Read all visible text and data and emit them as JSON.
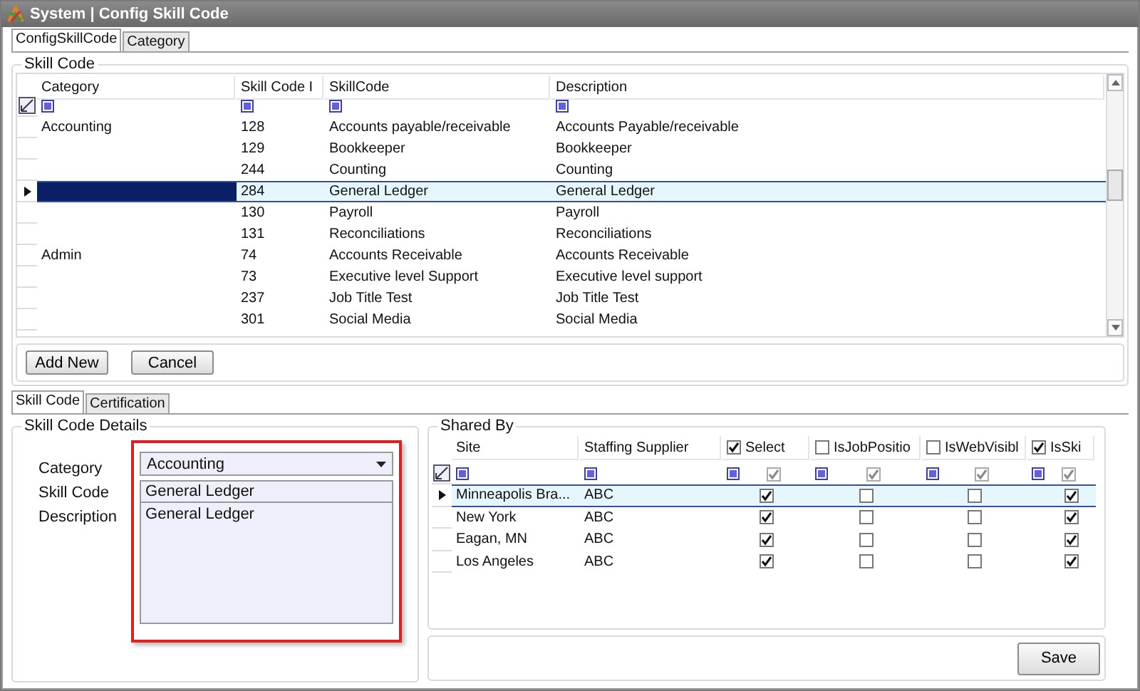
{
  "window": {
    "title": "System | Config Skill Code"
  },
  "top_tabs": [
    {
      "label": "ConfigSkillCode",
      "selected": true
    },
    {
      "label": "Category",
      "selected": false
    }
  ],
  "skill_code_group": {
    "title": "Skill Code",
    "columns": [
      "Category",
      "Skill Code I",
      "SkillCode",
      "Description"
    ],
    "rows": [
      {
        "category": "Accounting",
        "code": "128",
        "skill": "Accounts payable/receivable",
        "description": "Accounts Payable/receivable",
        "selected": false
      },
      {
        "code": "129",
        "skill": "Bookkeeper",
        "description": "Bookkeeper",
        "selected": false
      },
      {
        "code": "244",
        "skill": "Counting",
        "description": "Counting",
        "selected": false
      },
      {
        "code": "284",
        "skill": "General Ledger",
        "description": "General Ledger",
        "selected": true
      },
      {
        "code": "130",
        "skill": "Payroll",
        "description": "Payroll",
        "selected": false
      },
      {
        "code": "131",
        "skill": "Reconciliations",
        "description": "Reconciliations",
        "selected": false
      },
      {
        "category": "Admin",
        "code": "74",
        "skill": "Accounts Receivable",
        "description": "Accounts Receivable",
        "selected": false
      },
      {
        "code": "73",
        "skill": "Executive level Support",
        "description": "Executive level support",
        "selected": false
      },
      {
        "code": "237",
        "skill": "Job Title Test",
        "description": "Job Title Test",
        "selected": false
      },
      {
        "code": "301",
        "skill": "Social Media",
        "description": "Social Media",
        "selected": false
      }
    ]
  },
  "grid_buttons": [
    "Add New",
    "Cancel"
  ],
  "bottom_tabs": [
    {
      "label": "Skill Code",
      "selected": true
    },
    {
      "label": "Certification",
      "selected": false
    }
  ],
  "details": {
    "title": "Skill Code Details",
    "category_label": "Category",
    "skill_code_label": "Skill Code",
    "description_label": "Description",
    "category_value": "Accounting",
    "skill_code_value": "General Ledger",
    "description_value": "General Ledger"
  },
  "shared_by": {
    "title": "Shared By",
    "columns": [
      {
        "label": "Site",
        "kind": "text"
      },
      {
        "label": "Staffing Supplier",
        "kind": "text"
      },
      {
        "label": "Select",
        "kind": "check",
        "checked": true,
        "filter_checked": true
      },
      {
        "label": "IsJobPositio",
        "kind": "check",
        "checked": false,
        "filter_checked": true
      },
      {
        "label": "IsWebVisibl",
        "kind": "check",
        "checked": false,
        "filter_checked": true
      },
      {
        "label": "IsSki",
        "kind": "check",
        "checked": true,
        "filter_checked": true
      }
    ],
    "rows": [
      {
        "site": "Minneapolis Bra...",
        "supplier": "ABC",
        "checks": [
          true,
          false,
          false,
          true
        ],
        "selected": true
      },
      {
        "site": "New York",
        "supplier": "ABC",
        "checks": [
          true,
          false,
          false,
          true
        ],
        "selected": false
      },
      {
        "site": "Eagan, MN",
        "supplier": "ABC",
        "checks": [
          true,
          false,
          false,
          true
        ],
        "selected": false
      },
      {
        "site": "Los Angeles",
        "supplier": "ABC",
        "checks": [
          true,
          false,
          false,
          true
        ],
        "selected": false
      }
    ]
  },
  "save_button": "Save"
}
